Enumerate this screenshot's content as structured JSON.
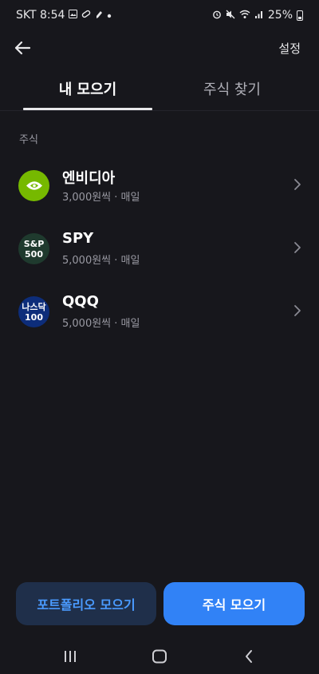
{
  "status_bar": {
    "carrier_time": "SKT 8:54",
    "notification_icons": [
      "image-icon",
      "pill-icon",
      "pen-icon",
      "dot-icon"
    ],
    "system_icons": [
      "alarm-icon",
      "mute-icon",
      "wifi-icon",
      "signal-icon"
    ],
    "battery": "25%"
  },
  "header": {
    "back_icon": "arrow-left-icon",
    "settings_label": "설정"
  },
  "tabs": [
    {
      "label": "내 모으기",
      "active": true
    },
    {
      "label": "주식 찾기",
      "active": false
    }
  ],
  "section": {
    "title": "주식"
  },
  "stocks": [
    {
      "name": "엔비디아",
      "detail": "3,000원씩 · 매일",
      "logo": "nvidia-logo",
      "logo_color": "#76b900",
      "logo_text": [
        "",
        ""
      ]
    },
    {
      "name": "SPY",
      "detail": "5,000원씩 · 매일",
      "logo": "sp500-logo",
      "logo_color": "#1f3a2e",
      "logo_text": [
        "S&P",
        "500"
      ]
    },
    {
      "name": "QQQ",
      "detail": "5,000원씩 · 매일",
      "logo": "nasdaq100-logo",
      "logo_color": "#0d2d7a",
      "logo_text": [
        "나스닥",
        "100"
      ]
    }
  ],
  "buttons": {
    "portfolio_label": "포트폴리오 모으기",
    "stock_label": "주식 모으기"
  },
  "colors": {
    "background": "#17171c",
    "primary": "#3182f6",
    "secondary_bg": "#1f2f4a",
    "secondary_text": "#4a9bff"
  },
  "nav": {
    "icons": [
      "recent-apps-icon",
      "home-icon",
      "back-icon"
    ]
  }
}
